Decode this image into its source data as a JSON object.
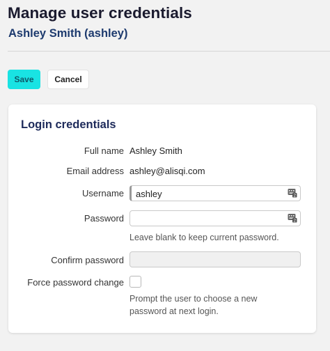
{
  "header": {
    "title": "Manage user credentials",
    "subtitle": "Ashley Smith (ashley)"
  },
  "toolbar": {
    "save_label": "Save",
    "cancel_label": "Cancel"
  },
  "card": {
    "title": "Login credentials",
    "full_name_label": "Full name",
    "full_name_value": "Ashley Smith",
    "email_label": "Email address",
    "email_value": "ashley@alisqi.com",
    "username_label": "Username",
    "username_value": "ashley",
    "password_label": "Password",
    "password_value": "",
    "password_help": "Leave blank to keep current password.",
    "confirm_label": "Confirm password",
    "confirm_value": "",
    "force_label": "Force password change",
    "force_checked": false,
    "force_help": "Prompt the user to choose a new password at next login."
  },
  "icons": {
    "field_icon": "password-manager-icon"
  },
  "colors": {
    "accent": "#19e3e3",
    "title": "#1a1a2e",
    "subtitle": "#1d3a6e"
  }
}
